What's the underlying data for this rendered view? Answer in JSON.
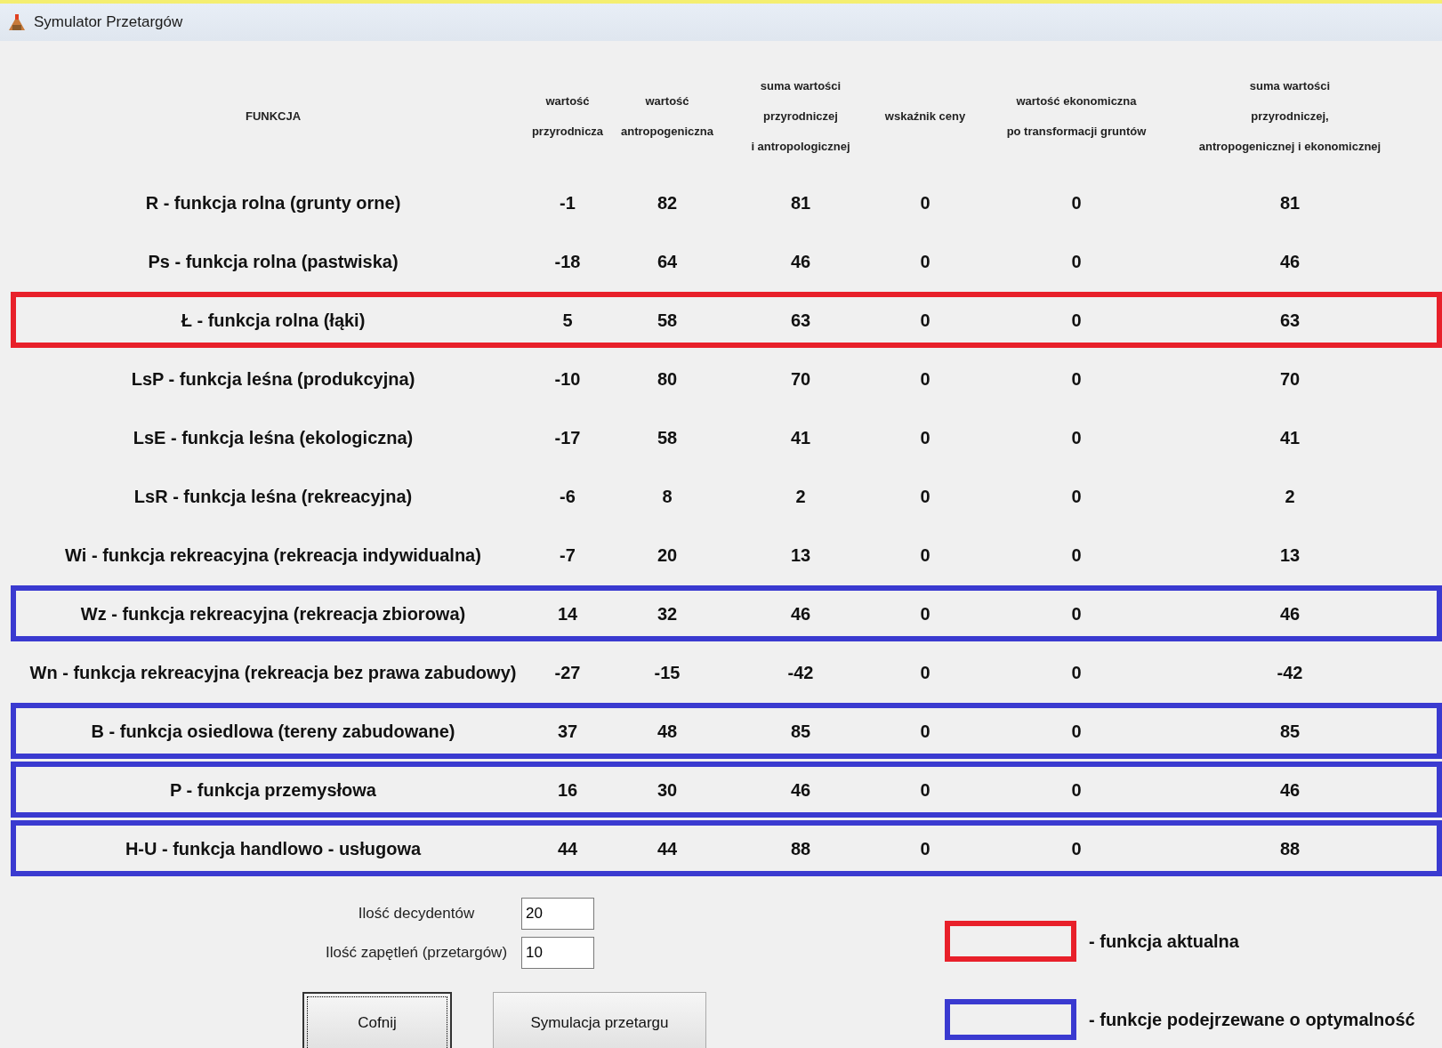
{
  "window": {
    "title": "Symulator Przetargów"
  },
  "table": {
    "columns": [
      "FUNKCJA",
      "wartość\nprzyrodnicza",
      "wartość\nantropogeniczna",
      "suma wartości\nprzyrodniczej\ni antropologicznej",
      "wskaźnik ceny",
      "wartość ekonomiczna\npo transformacji gruntów",
      "suma wartości\nprzyrodniczej,\nantropogenicznej i ekonomicznej"
    ],
    "rows": [
      {
        "kind": "plain",
        "cells": [
          "R - funkcja rolna (grunty orne)",
          "-1",
          "82",
          "81",
          "0",
          "0",
          "81"
        ]
      },
      {
        "kind": "plain",
        "cells": [
          "Ps - funkcja rolna (pastwiska)",
          "-18",
          "64",
          "46",
          "0",
          "0",
          "46"
        ]
      },
      {
        "kind": "current",
        "cells": [
          "Ł - funkcja rolna (łąki)",
          "5",
          "58",
          "63",
          "0",
          "0",
          "63"
        ]
      },
      {
        "kind": "plain",
        "cells": [
          "LsP - funkcja leśna (produkcyjna)",
          "-10",
          "80",
          "70",
          "0",
          "0",
          "70"
        ]
      },
      {
        "kind": "plain",
        "cells": [
          "LsE -  funkcja leśna (ekologiczna)",
          "-17",
          "58",
          "41",
          "0",
          "0",
          "41"
        ]
      },
      {
        "kind": "plain",
        "cells": [
          "LsR - funkcja leśna (rekreacyjna)",
          "-6",
          "8",
          "2",
          "0",
          "0",
          "2"
        ]
      },
      {
        "kind": "plain",
        "cells": [
          "Wi - funkcja rekreacyjna (rekreacja indywidualna)",
          "-7",
          "20",
          "13",
          "0",
          "0",
          "13"
        ]
      },
      {
        "kind": "suspected",
        "cells": [
          "Wz - funkcja rekreacyjna (rekreacja zbiorowa)",
          "14",
          "32",
          "46",
          "0",
          "0",
          "46"
        ]
      },
      {
        "kind": "plain",
        "cells": [
          "Wn - funkcja rekreacyjna (rekreacja bez prawa zabudowy)",
          "-27",
          "-15",
          "-42",
          "0",
          "0",
          "-42"
        ]
      },
      {
        "kind": "suspected",
        "cells": [
          "B - funkcja osiedlowa (tereny zabudowane)",
          "37",
          "48",
          "85",
          "0",
          "0",
          "85"
        ]
      },
      {
        "kind": "suspected",
        "cells": [
          "P - funkcja przemysłowa",
          "16",
          "30",
          "46",
          "0",
          "0",
          "46"
        ]
      },
      {
        "kind": "suspected",
        "cells": [
          "H-U - funkcja handlowo - usługowa",
          "44",
          "44",
          "88",
          "0",
          "0",
          "88"
        ]
      }
    ]
  },
  "fields": [
    {
      "label": "Ilość decydentów",
      "value": "20"
    },
    {
      "label": "Ilość zapętleń (przetargów)",
      "value": "10"
    }
  ],
  "buttons": [
    {
      "label": "Cofnij",
      "focused": true
    },
    {
      "label": "Symulacja przetargu",
      "focused": false
    }
  ],
  "legend": [
    {
      "kind": "current",
      "label": "- funkcja aktualna"
    },
    {
      "kind": "suspected",
      "label": "- funkcje podejrzewane o optymalność"
    }
  ]
}
